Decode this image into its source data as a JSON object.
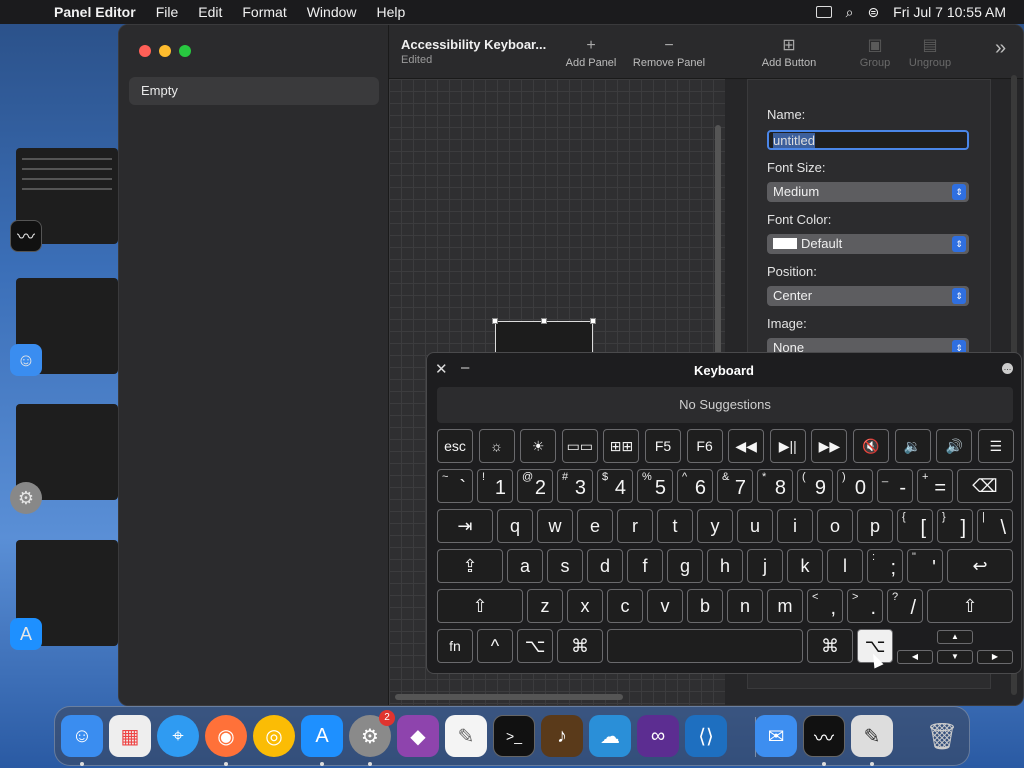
{
  "menubar": {
    "app_name": "Panel Editor",
    "menus": [
      "File",
      "Edit",
      "Format",
      "Window",
      "Help"
    ],
    "datetime": "Fri Jul 7  10:55 AM"
  },
  "sidebar": {
    "row_label": "Empty"
  },
  "toolbar": {
    "doc_title": "Accessibility Keyboar...",
    "doc_status": "Edited",
    "buttons": [
      {
        "label": "Add Panel",
        "icon": "+"
      },
      {
        "label": "Remove Panel",
        "icon": "−"
      },
      {
        "label": "Add Button",
        "icon": "⊞"
      },
      {
        "label": "Group",
        "icon": "▣"
      },
      {
        "label": "Ungroup",
        "icon": "▤"
      }
    ],
    "overflow_icon": "»"
  },
  "inspector": {
    "name_label": "Name:",
    "name_value": "untitled",
    "font_size_label": "Font Size:",
    "font_size_value": "Medium",
    "font_color_label": "Font Color:",
    "font_color_value": "Default",
    "position_label": "Position:",
    "position_value": "Center",
    "image_label": "Image:",
    "image_value": "None"
  },
  "keyboard": {
    "title": "Keyboard",
    "suggestions": "No Suggestions",
    "fn_row": [
      "esc",
      "☼",
      "☀",
      "▭▭",
      "⊞⊞",
      "F5",
      "F6",
      "◀◀",
      "▶||",
      "▶▶",
      "🔇",
      "🔉",
      "🔊",
      "☰"
    ],
    "number_row": [
      {
        "up": "~",
        "dn": "`"
      },
      {
        "up": "!",
        "dn": "1"
      },
      {
        "up": "@",
        "dn": "2"
      },
      {
        "up": "#",
        "dn": "3"
      },
      {
        "up": "$",
        "dn": "4"
      },
      {
        "up": "%",
        "dn": "5"
      },
      {
        "up": "^",
        "dn": "6"
      },
      {
        "up": "&",
        "dn": "7"
      },
      {
        "up": "*",
        "dn": "8"
      },
      {
        "up": "(",
        "dn": "9"
      },
      {
        "up": ")",
        "dn": "0"
      },
      {
        "up": "_",
        "dn": "-"
      },
      {
        "up": "+",
        "dn": "="
      }
    ],
    "delete_key": "⌫",
    "tab_key": "⇥",
    "qwerty_row": [
      "q",
      "w",
      "e",
      "r",
      "t",
      "y",
      "u",
      "i",
      "o",
      "p"
    ],
    "bracket_keys": [
      {
        "up": "{",
        "dn": "["
      },
      {
        "up": "}",
        "dn": "]"
      },
      {
        "up": "|",
        "dn": "\\"
      }
    ],
    "caps_key": "⇪",
    "home_row": [
      "a",
      "s",
      "d",
      "f",
      "g",
      "h",
      "j",
      "k",
      "l"
    ],
    "home_punct": [
      {
        "up": ":",
        "dn": ";"
      },
      {
        "up": "\"",
        "dn": "'"
      }
    ],
    "return_key": "↩",
    "shift_key": "⇧",
    "bottom_row": [
      "z",
      "x",
      "c",
      "v",
      "b",
      "n",
      "m"
    ],
    "bottom_punct": [
      {
        "up": "<",
        "dn": ","
      },
      {
        "up": ">",
        "dn": "."
      },
      {
        "up": "?",
        "dn": "/"
      }
    ],
    "fn_key": "fn",
    "ctrl_key": "^",
    "option_key": "⌥",
    "command_key": "⌘",
    "arrows": {
      "up": "▲",
      "left": "◀",
      "down": "▼",
      "right": "▶"
    }
  },
  "dock": {
    "settings_badge": "2"
  }
}
